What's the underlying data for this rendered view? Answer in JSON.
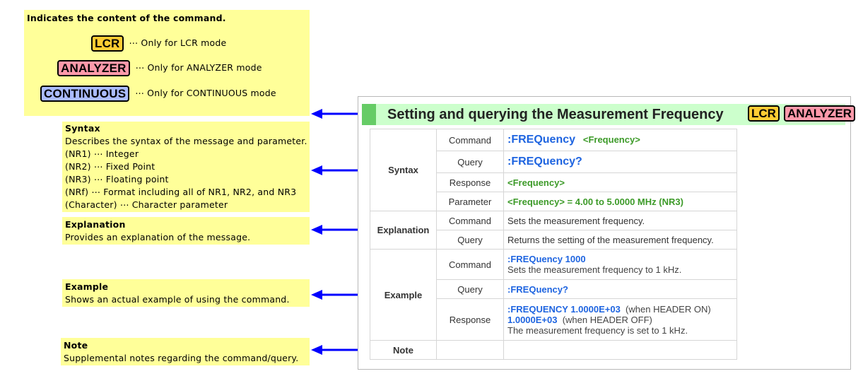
{
  "legend": {
    "heading": "Indicates the content of the command.",
    "items": [
      {
        "tag": "LCR",
        "desc": "⋯ Only for LCR mode"
      },
      {
        "tag": "ANALYZER",
        "desc": "⋯ Only for ANALYZER mode"
      },
      {
        "tag": "CONTINUOUS",
        "desc": "⋯ Only for CONTINUOUS mode"
      }
    ]
  },
  "notes": {
    "syntax": {
      "title": "Syntax",
      "lines": [
        "Describes the syntax of the message and parameter.",
        "(NR1) ⋯  Integer",
        "(NR2) ⋯  Fixed Point",
        "(NR3) ⋯  Floating point",
        "(NRf)  ⋯  Format including all of NR1, NR2, and NR3",
        "(Character) ⋯  Character parameter"
      ]
    },
    "explanation": {
      "title": "Explanation",
      "text": "Provides an explanation of the message."
    },
    "example": {
      "title": "Example",
      "text": "Shows an actual example of using the command."
    },
    "note": {
      "title": "Note",
      "text": "Supplemental notes regarding the command/query."
    }
  },
  "doc": {
    "title": "Setting and querying the Measurement Frequency",
    "tags": [
      "LCR",
      "ANALYZER"
    ],
    "sections": {
      "syntax": "Syntax",
      "explanation": "Explanation",
      "example": "Example",
      "note": "Note"
    },
    "labels": {
      "command": "Command",
      "query": "Query",
      "response": "Response",
      "parameter": "Parameter"
    },
    "syntax": {
      "command": ":FREQuency",
      "command_arg": "<Frequency>",
      "query": ":FREQuency?",
      "response": "<Frequency>",
      "parameter": "<Frequency> = 4.00 to 5.0000 MHz (NR3)"
    },
    "explanation": {
      "command": "Sets the measurement frequency.",
      "query": "Returns the setting of the measurement frequency."
    },
    "example": {
      "command_code": ":FREQuency 1000",
      "command_text": "Sets the measurement frequency to 1 kHz.",
      "query_code": ":FREQuency?",
      "response_code1": ":FREQUENCY 1.0000E+03",
      "response_note1": "(when HEADER ON)",
      "response_code2": "1.0000E+03",
      "response_note2": "(when HEADER OFF)",
      "response_text": "The measurement frequency is set to 1 kHz."
    }
  },
  "colors": {
    "note_bg": "#ffff99",
    "arrow": "#0000ff",
    "title_bg": "#ccffcc",
    "title_bar": "#66cc66",
    "command_blue": "#1e64e0",
    "param_green": "#3c9a28"
  }
}
